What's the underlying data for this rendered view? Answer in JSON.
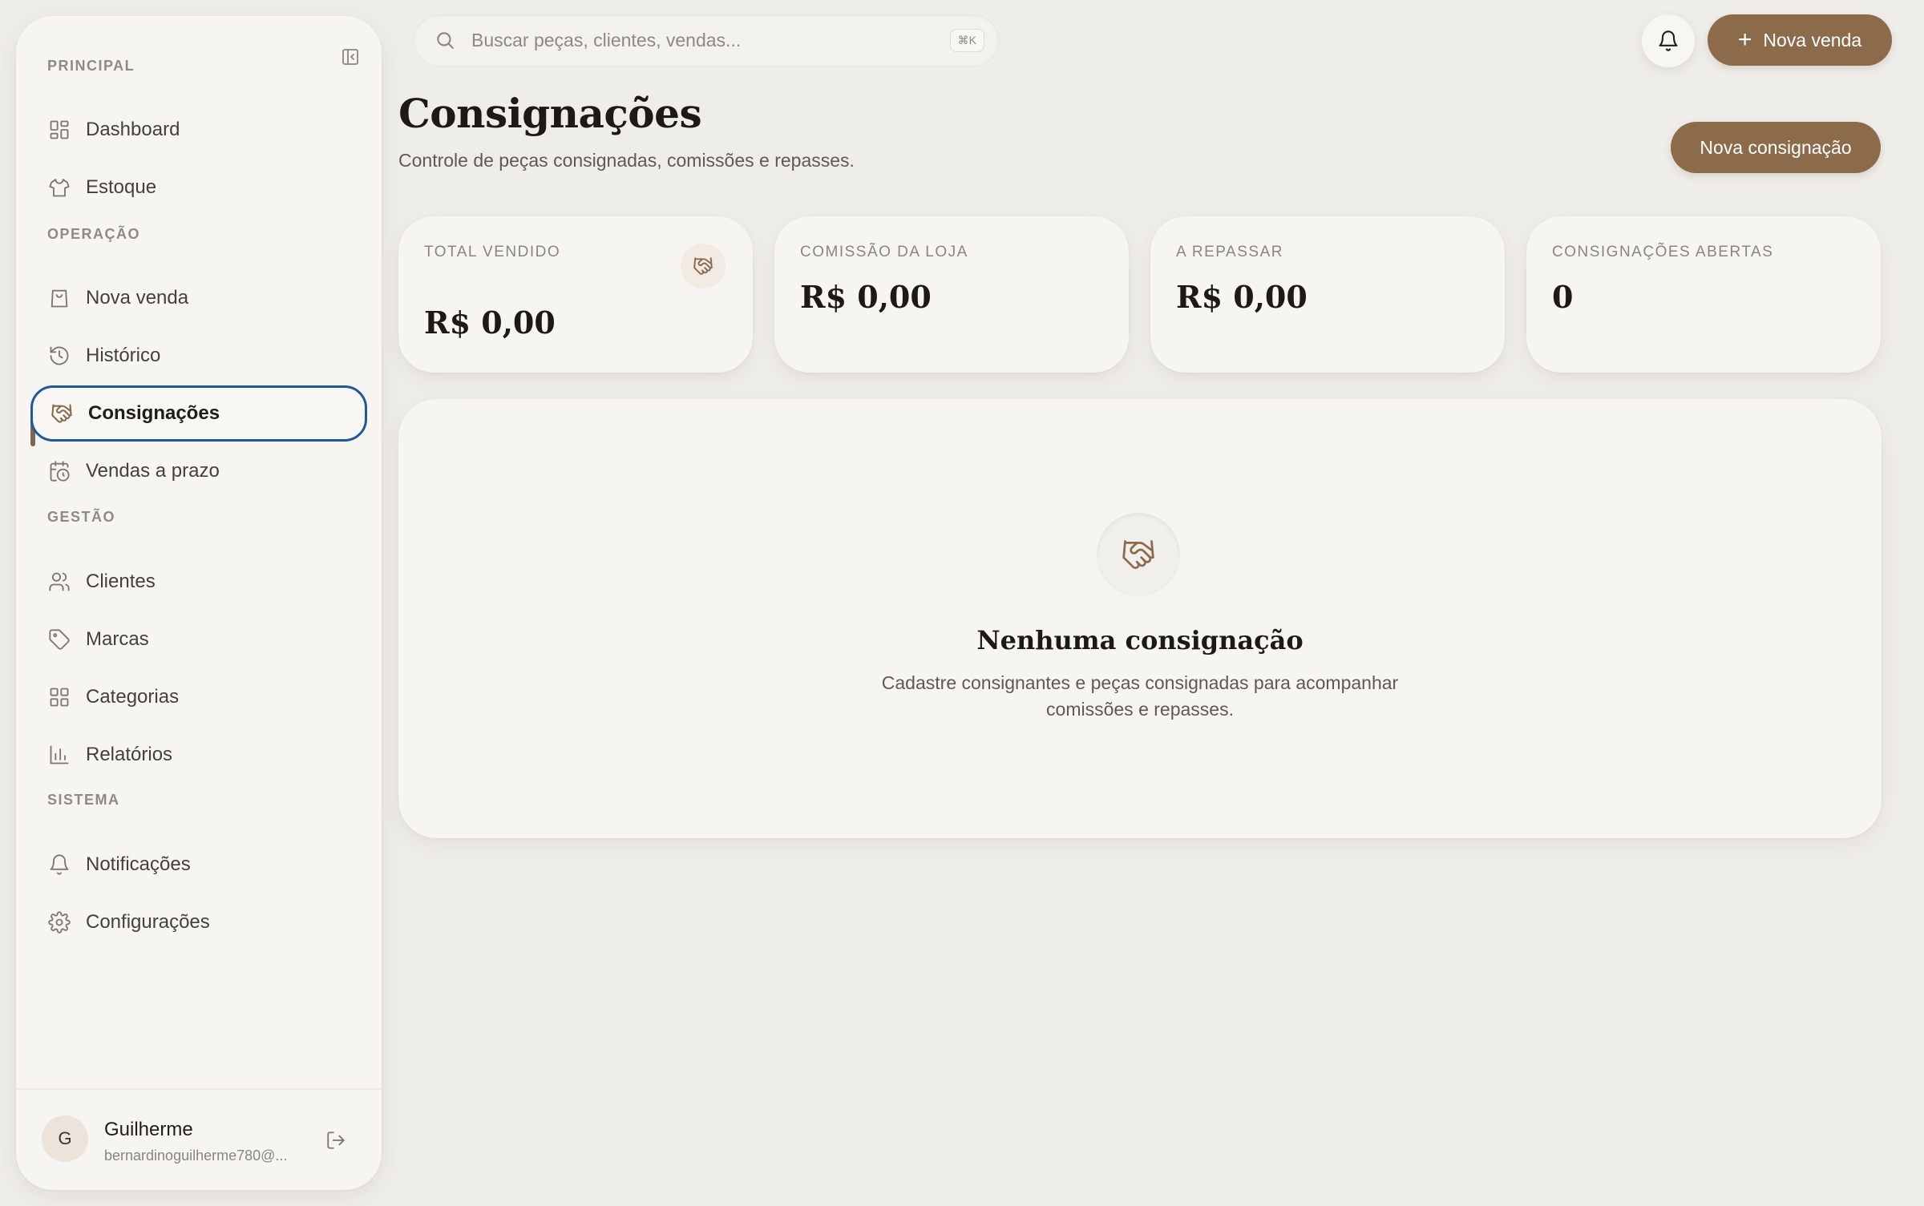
{
  "search": {
    "placeholder": "Buscar peças, clientes, vendas...",
    "shortcut": "⌘K"
  },
  "topbar": {
    "new_sale_label": "Nova venda",
    "plus_glyph": "+"
  },
  "sidebar": {
    "sections": [
      {
        "label": "PRINCIPAL"
      },
      {
        "label": "OPERAÇÃO"
      },
      {
        "label": "GESTÃO"
      },
      {
        "label": "SISTEMA"
      }
    ],
    "items": [
      {
        "label": "Dashboard",
        "icon": "grid-icon"
      },
      {
        "label": "Estoque",
        "icon": "shirt-icon"
      },
      {
        "label": "Nova venda",
        "icon": "shopping-bag-icon"
      },
      {
        "label": "Histórico",
        "icon": "history-icon"
      },
      {
        "label": "Consignações",
        "icon": "handshake-icon",
        "active": true
      },
      {
        "label": "Vendas a prazo",
        "icon": "calendar-clock-icon"
      },
      {
        "label": "Clientes",
        "icon": "users-icon"
      },
      {
        "label": "Marcas",
        "icon": "tag-icon"
      },
      {
        "label": "Categorias",
        "icon": "grid-icon"
      },
      {
        "label": "Relatórios",
        "icon": "bar-chart-icon"
      },
      {
        "label": "Notificações",
        "icon": "bell-icon"
      },
      {
        "label": "Configurações",
        "icon": "gear-icon"
      }
    ],
    "user": {
      "initial": "G",
      "name": "Guilherme",
      "email": "bernardinoguilherme780@..."
    }
  },
  "page": {
    "title": "Consignações",
    "subtitle": "Controle de peças consignadas, comissões e repasses.",
    "action_label": "Nova consignação"
  },
  "stats": [
    {
      "label": "TOTAL VENDIDO",
      "value": "R$ 0,00"
    },
    {
      "label": "COMISSÃO DA LOJA",
      "value": "R$ 0,00"
    },
    {
      "label": "A REPASSAR",
      "value": "R$ 0,00"
    },
    {
      "label": "CONSIGNAÇÕES ABERTAS",
      "value": "0"
    }
  ],
  "empty_state": {
    "title": "Nenhuma consignação",
    "description": "Cadastre consignantes e peças consignadas para acompanhar comissões e repasses."
  },
  "colors": {
    "accent": "#8c6b4b",
    "background": "#efedea",
    "card": "#f6f5f2",
    "focus_ring": "#1d5a9a"
  }
}
